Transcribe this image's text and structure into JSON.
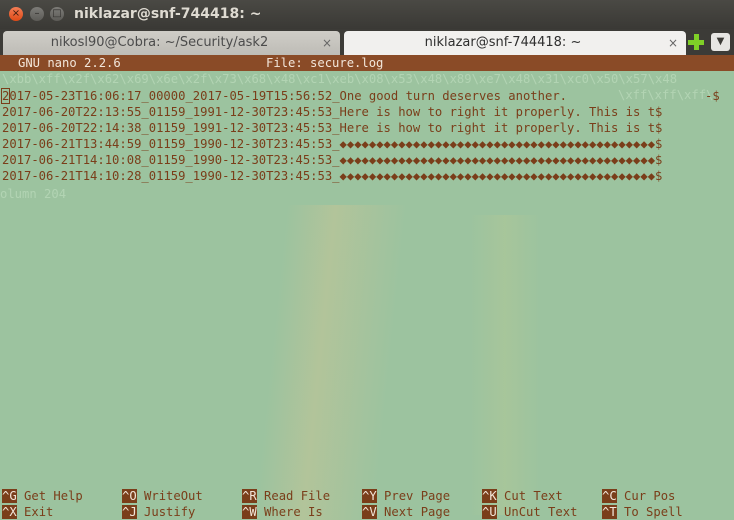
{
  "window": {
    "title": "niklazar@snf-744418: ~"
  },
  "tabs": [
    {
      "label": "nikosl90@Cobra: ~/Security/ask2",
      "close": "×"
    },
    {
      "label": "niklazar@snf-744418: ~",
      "close": "×"
    }
  ],
  "nano": {
    "version": "GNU nano 2.2.6",
    "file": "File: secure.log",
    "bg_text": "\\xbb\\xff\\x2f\\x62\\x69\\x6e\\x2f\\x73\\x68\\x48\\xc1\\xeb\\x08\\x53\\x48\\x89\\xe7\\x48\\x31\\xc0\\x50\\x57\\x48",
    "bg_text2": "\\xff\\xff\\xff\\",
    "lines": [
      "2017-05-23T16:06:17_00000_2017-05-19T15:56:52_One good turn deserves another.",
      "2017-06-20T22:13:55_01159_1991-12-30T23:45:53_Here is how to right it properly. This is t$",
      "2017-06-20T22:14:38_01159_1991-12-30T23:45:53_Here is how to right it properly. This is t$",
      "2017-06-21T13:44:59_01159_1990-12-30T23:45:53_◆◆◆◆◆◆◆◆◆◆◆◆◆◆◆◆◆◆◆◆◆◆◆◆◆◆◆◆◆◆◆◆◆◆◆◆◆◆◆◆◆◆◆$",
      "2017-06-21T14:10:08_01159_1990-12-30T23:45:53_◆◆◆◆◆◆◆◆◆◆◆◆◆◆◆◆◆◆◆◆◆◆◆◆◆◆◆◆◆◆◆◆◆◆◆◆◆◆◆◆◆◆◆$",
      "2017-06-21T14:10:28_01159_1990-12-30T23:45:53_◆◆◆◆◆◆◆◆◆◆◆◆◆◆◆◆◆◆◆◆◆◆◆◆◆◆◆◆◆◆◆◆◆◆◆◆◆◆◆◆◆◆◆$"
    ],
    "line1_tail": "-$",
    "ghost_status": "olumn 204",
    "help": [
      {
        "key": "^G",
        "label": "Get Help"
      },
      {
        "key": "^O",
        "label": "WriteOut"
      },
      {
        "key": "^R",
        "label": "Read File"
      },
      {
        "key": "^Y",
        "label": "Prev Page"
      },
      {
        "key": "^K",
        "label": "Cut Text"
      },
      {
        "key": "^C",
        "label": "Cur Pos"
      },
      {
        "key": "^X",
        "label": "Exit"
      },
      {
        "key": "^J",
        "label": "Justify"
      },
      {
        "key": "^W",
        "label": "Where Is"
      },
      {
        "key": "^V",
        "label": "Next Page"
      },
      {
        "key": "^U",
        "label": "UnCut Text"
      },
      {
        "key": "^T",
        "label": "To Spell"
      }
    ]
  }
}
